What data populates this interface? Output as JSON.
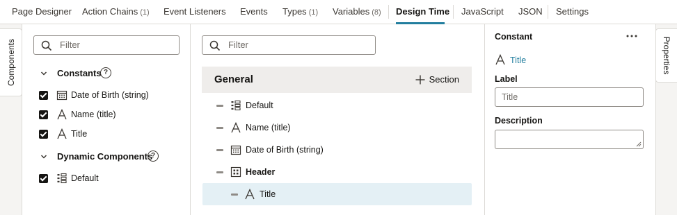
{
  "tabs": [
    {
      "label": "Page Designer",
      "count": ""
    },
    {
      "label": "Action Chains",
      "count": "(1)"
    },
    {
      "label": "Event Listeners",
      "count": ""
    },
    {
      "label": "Events",
      "count": ""
    },
    {
      "label": "Types",
      "count": "(1)"
    },
    {
      "label": "Variables",
      "count": "(8)"
    },
    {
      "label": "Design Time",
      "count": ""
    },
    {
      "label": "JavaScript",
      "count": ""
    },
    {
      "label": "JSON",
      "count": ""
    },
    {
      "label": "Settings",
      "count": ""
    }
  ],
  "active_tab": "Design Time",
  "side_tabs": {
    "left": "Components",
    "right": "Properties"
  },
  "components": {
    "filter_placeholder": "Filter",
    "constants_heading": "Constants",
    "constants": [
      {
        "label": "Date of Birth (string)",
        "icon": "calendar-icon",
        "checked": true
      },
      {
        "label": "Name (title)",
        "icon": "text-icon",
        "checked": true
      },
      {
        "label": "Title",
        "icon": "text-icon",
        "checked": true
      }
    ],
    "dynamic_heading": "Dynamic Components",
    "dynamic": [
      {
        "label": "Default",
        "icon": "form-layout-icon",
        "checked": true
      }
    ]
  },
  "structure": {
    "filter_placeholder": "Filter",
    "group_title": "General",
    "section_button": "Section",
    "items": [
      {
        "label": "Default",
        "icon": "form-layout-icon"
      },
      {
        "label": "Name (title)",
        "icon": "text-icon"
      },
      {
        "label": "Date of Birth (string)",
        "icon": "calendar-icon"
      },
      {
        "label": "Header",
        "icon": "grid-icon"
      },
      {
        "label": "Title",
        "icon": "text-icon"
      }
    ]
  },
  "properties": {
    "title": "Constant",
    "constant_link": "Title",
    "label_field": {
      "label": "Label",
      "placeholder": "Title"
    },
    "description_field": {
      "label": "Description",
      "value": ""
    }
  },
  "colors": {
    "accent": "#227e9e",
    "selected_row": "#e4f0f5",
    "group_bar": "#efedeb"
  }
}
